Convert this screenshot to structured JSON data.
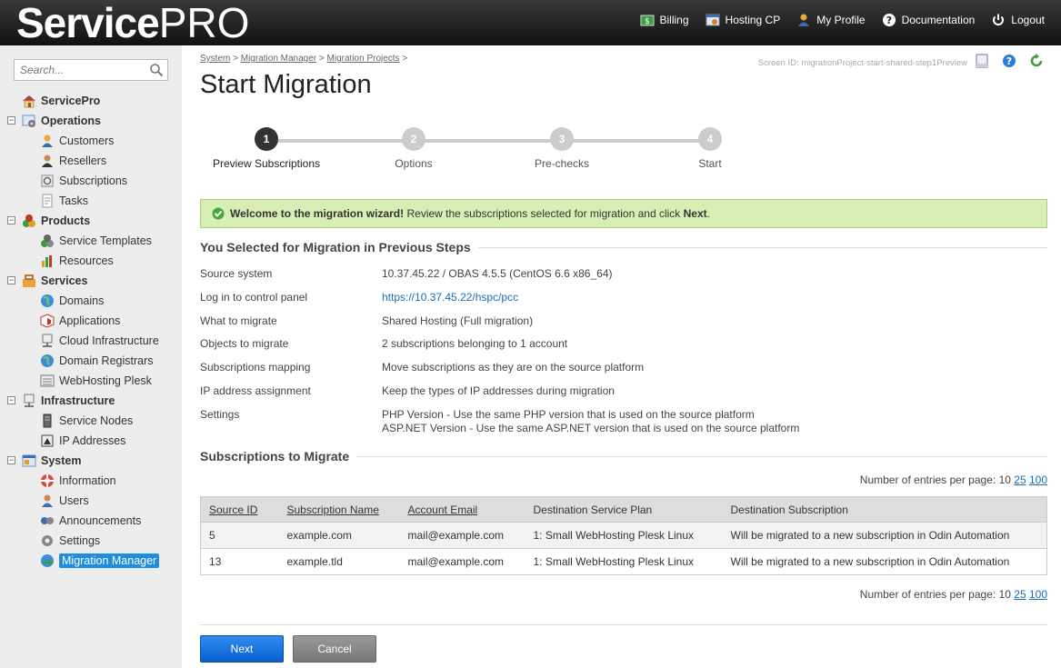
{
  "header": {
    "logo_bold": "Service",
    "logo_light": "PRO",
    "nav": [
      {
        "label": "Billing",
        "icon": "billing-icon"
      },
      {
        "label": "Hosting CP",
        "icon": "hosting-cp-icon"
      },
      {
        "label": "My Profile",
        "icon": "profile-icon"
      },
      {
        "label": "Documentation",
        "icon": "help-icon"
      },
      {
        "label": "Logout",
        "icon": "power-icon"
      }
    ]
  },
  "sidebar": {
    "search_placeholder": "Search...",
    "root": "ServicePro",
    "sections": [
      {
        "label": "Operations",
        "items": [
          "Customers",
          "Resellers",
          "Subscriptions",
          "Tasks"
        ]
      },
      {
        "label": "Products",
        "items": [
          "Service Templates",
          "Resources"
        ]
      },
      {
        "label": "Services",
        "items": [
          "Domains",
          "Applications",
          "Cloud Infrastructure",
          "Domain Registrars",
          "WebHosting Plesk"
        ]
      },
      {
        "label": "Infrastructure",
        "items": [
          "Service Nodes",
          "IP Addresses"
        ]
      },
      {
        "label": "System",
        "items": [
          "Information",
          "Users",
          "Announcements",
          "Settings",
          "Migration Manager"
        ]
      }
    ],
    "active_item": "Migration Manager"
  },
  "breadcrumb": [
    "System",
    "Migration Manager",
    "Migration Projects"
  ],
  "breadcrumb_sep": ">",
  "screen_id": "Screen ID:  migrationProject-start-shared-step1Preview",
  "page_title": "Start Migration",
  "steps": [
    {
      "num": "1",
      "label": "Preview Subscriptions"
    },
    {
      "num": "2",
      "label": "Options"
    },
    {
      "num": "3",
      "label": "Pre-checks"
    },
    {
      "num": "4",
      "label": "Start"
    }
  ],
  "active_step": 1,
  "message": {
    "bold": "Welcome to the migration wizard!",
    "text": " Review the subscriptions selected for migration and click ",
    "bold2": "Next",
    "end": "."
  },
  "section1_title": "You Selected for Migration in Previous Steps",
  "summary": {
    "source_system": {
      "label": "Source system",
      "value": "10.37.45.22 / OBAS 4.5.5 (CentOS 6.6 x86_64)"
    },
    "login": {
      "label": "Log in to control panel",
      "value": "https://10.37.45.22/hspc/pcc"
    },
    "what": {
      "label": "What to migrate",
      "value": "Shared Hosting (Full migration)"
    },
    "objects": {
      "label": "Objects to migrate",
      "value": "2 subscriptions belonging to 1 account"
    },
    "mapping": {
      "label": "Subscriptions mapping",
      "value": "Move subscriptions as they are on the source platform"
    },
    "ip": {
      "label": "IP address assignment",
      "value": "Keep the types of IP addresses during migration"
    },
    "settings": {
      "label": "Settings",
      "value1": "PHP Version - Use the same PHP version that is used on the source platform",
      "value2": "ASP.NET Version - Use the same ASP.NET version that is used on the source platform"
    }
  },
  "section2_title": "Subscriptions to Migrate",
  "pager": {
    "label": "Number of entries per page:",
    "p10": "10",
    "p25": "25",
    "p100": "100"
  },
  "table": {
    "headers": [
      "Source ID",
      "Subscription Name",
      "Account Email",
      "Destination Service Plan",
      "Destination Subscription"
    ],
    "rows": [
      [
        "5",
        "example.com",
        "mail@example.com",
        "1: Small WebHosting Plesk Linux",
        "Will be migrated to a new subscription in Odin Automation"
      ],
      [
        "13",
        "example.tld",
        "mail@example.com",
        "1: Small WebHosting Plesk Linux",
        "Will be migrated to a new subscription in Odin Automation"
      ]
    ]
  },
  "buttons": {
    "next": "Next",
    "cancel": "Cancel"
  },
  "colors": {
    "accent": "#1e8de0",
    "success_bg": "#d7efb5",
    "header_bg": "#1a1a1a"
  }
}
